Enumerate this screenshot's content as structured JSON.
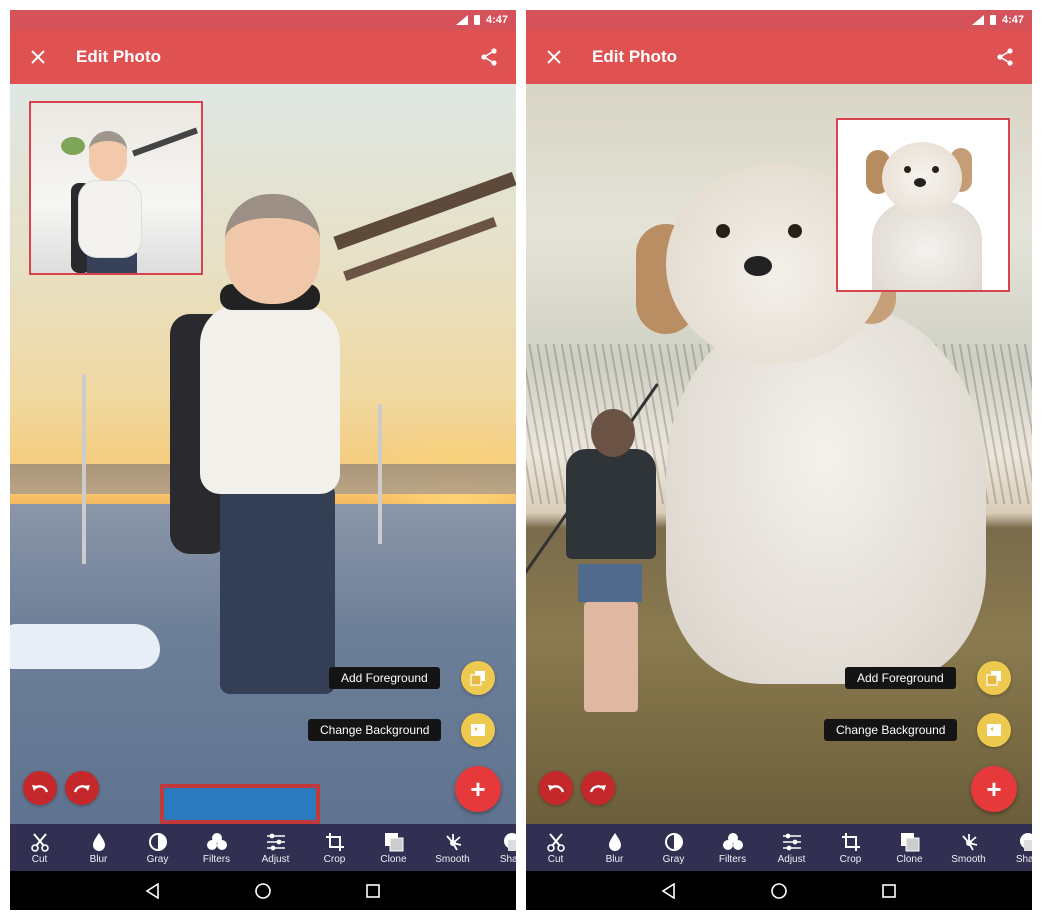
{
  "screens": [
    {
      "status": {
        "time": "4:47",
        "network": "LTE"
      },
      "appbar": {
        "title": "Edit Photo",
        "close_icon": "close-icon",
        "share_icon": "share-icon"
      },
      "photo": {
        "description": "Child in aviator hat holding toy plane composited onto airport runway at sunset",
        "inset_description": "Original photo of child indoors"
      },
      "actions": {
        "add_foreground": "Add Foreground",
        "change_background": "Change Background",
        "add": "+"
      },
      "tools": [
        "Cut",
        "Blur",
        "Gray",
        "Filters",
        "Adjust",
        "Crop",
        "Clone",
        "Smooth",
        "Shad"
      ]
    },
    {
      "status": {
        "time": "4:47",
        "network": "LTE"
      },
      "appbar": {
        "title": "Edit Photo",
        "close_icon": "close-icon",
        "share_icon": "share-icon"
      },
      "photo": {
        "description": "Giant white dog composited next to woman holding leash in a grassy field",
        "inset_description": "Original dog photo on white background"
      },
      "actions": {
        "add_foreground": "Add Foreground",
        "change_background": "Change Background",
        "add": "+"
      },
      "tools": [
        "Cut",
        "Blur",
        "Gray",
        "Filters",
        "Adjust",
        "Crop",
        "Clone",
        "Smooth",
        "Shad"
      ]
    }
  ],
  "colors": {
    "appbar": "#e05152",
    "statusbar": "#d5525a",
    "toolbar": "#312f52",
    "fab": "#e5393c",
    "fab_mini": "#edc94f",
    "undo": "#c4282b",
    "inset_border": "#d6454d"
  }
}
